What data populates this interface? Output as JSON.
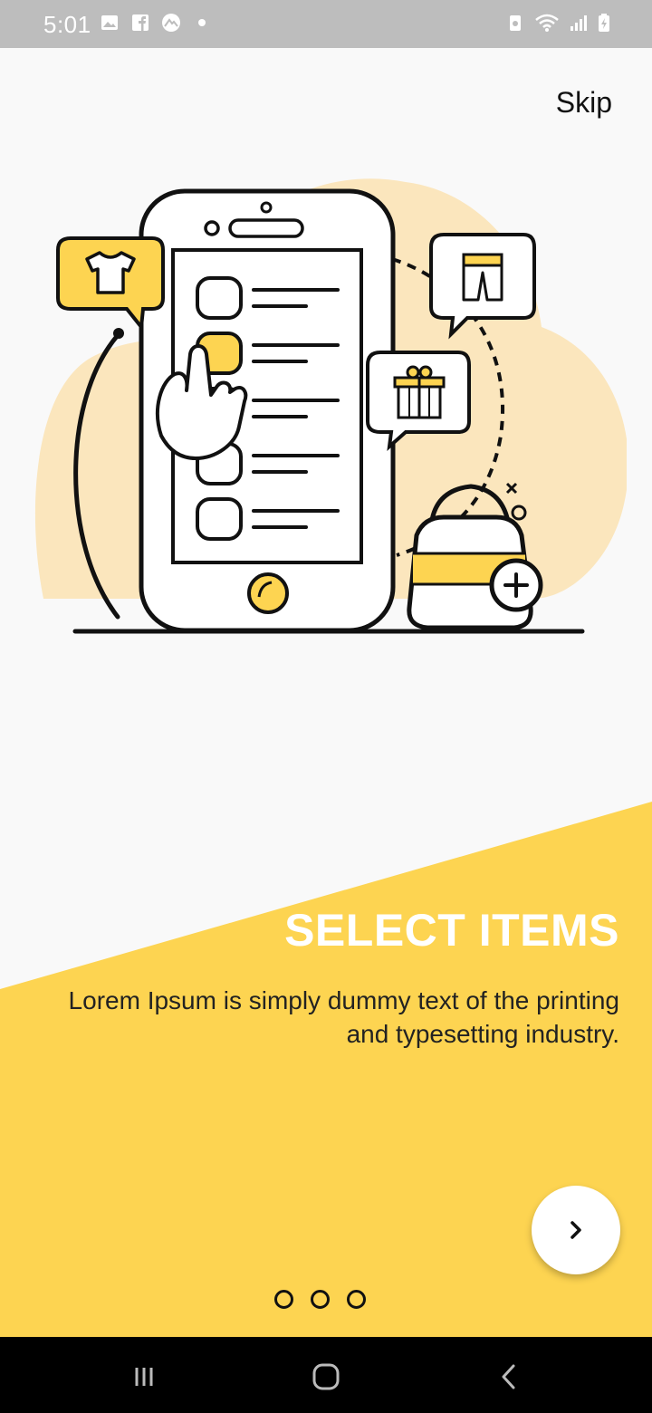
{
  "status_bar": {
    "time": "5:01",
    "left_icons": [
      "gallery-icon",
      "facebook-icon",
      "app-icon",
      "dot-icon"
    ],
    "right_icons": [
      "battery-saver-icon",
      "wifi-icon",
      "signal-icon",
      "battery-icon"
    ]
  },
  "onboarding": {
    "skip_label": "Skip",
    "title": "SELECT ITEMS",
    "description": "Lorem Ipsum is simply dummy text of the printing and typesetting industry.",
    "next_icon": "chevron-right-icon",
    "page_count": 3,
    "current_page": 1
  },
  "nav_bar": {
    "buttons": [
      "recent-apps-icon",
      "home-icon",
      "back-icon"
    ]
  },
  "colors": {
    "accent": "#fdd451",
    "illustration_bg": "#fbe6bd",
    "status_bar": "#bdbdbd",
    "background": "#f9f9f9",
    "title_text": "#ffffff"
  }
}
